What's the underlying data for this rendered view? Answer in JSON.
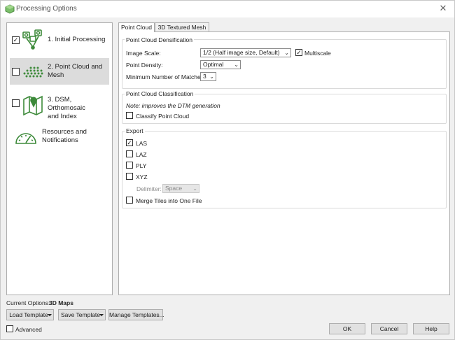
{
  "window": {
    "title": "Processing Options",
    "close_glyph": "✕"
  },
  "sidebar": {
    "items": [
      {
        "label_line1": "1. Initial Processing",
        "label_line2": "",
        "checked": true,
        "icon": "initial-processing-icon"
      },
      {
        "label_line1": "2. Point Cloud and",
        "label_line2": "Mesh",
        "checked": false,
        "icon": "point-cloud-icon"
      },
      {
        "label_line1": "3. DSM, Orthomosaic",
        "label_line2": "and Index",
        "checked": false,
        "icon": "dsm-map-icon"
      },
      {
        "label_line1": "Resources and",
        "label_line2": "Notifications",
        "checked": null,
        "icon": "gauge-icon"
      }
    ]
  },
  "tabs": [
    {
      "label": "Point Cloud",
      "active": true
    },
    {
      "label": "3D Textured Mesh",
      "active": false
    }
  ],
  "densification": {
    "title": "Point Cloud Densification",
    "image_scale_label": "Image Scale:",
    "image_scale_value": "1/2 (Half image size, Default)",
    "multiscale_label": "Multiscale",
    "multiscale_checked": true,
    "point_density_label": "Point Density:",
    "point_density_value": "Optimal",
    "min_matches_label": "Minimum Number of Matches:",
    "min_matches_value": "3"
  },
  "classification": {
    "title": "Point Cloud Classification",
    "note": "Note: improves the DTM generation",
    "classify_label": "Classify Point Cloud",
    "classify_checked": false
  },
  "export": {
    "title": "Export",
    "formats": [
      {
        "label": "LAS",
        "checked": true
      },
      {
        "label": "LAZ",
        "checked": false
      },
      {
        "label": "PLY",
        "checked": false
      },
      {
        "label": "XYZ",
        "checked": false
      }
    ],
    "delimiter_label": "Delimiter:",
    "delimiter_value": "Space",
    "merge_label": "Merge Tiles into One File",
    "merge_checked": false
  },
  "footer": {
    "current_options_label": "Current Options:",
    "current_options_value": "3D Maps",
    "load_template": "Load Template",
    "save_template": "Save Template",
    "manage_templates": "Manage Templates...",
    "advanced_label": "Advanced",
    "advanced_checked": false,
    "ok": "OK",
    "cancel": "Cancel",
    "help": "Help"
  },
  "colors": {
    "icon_green": "#3d8a3a",
    "selected_bg": "#dcdcdc",
    "panel_border": "#adadad"
  }
}
